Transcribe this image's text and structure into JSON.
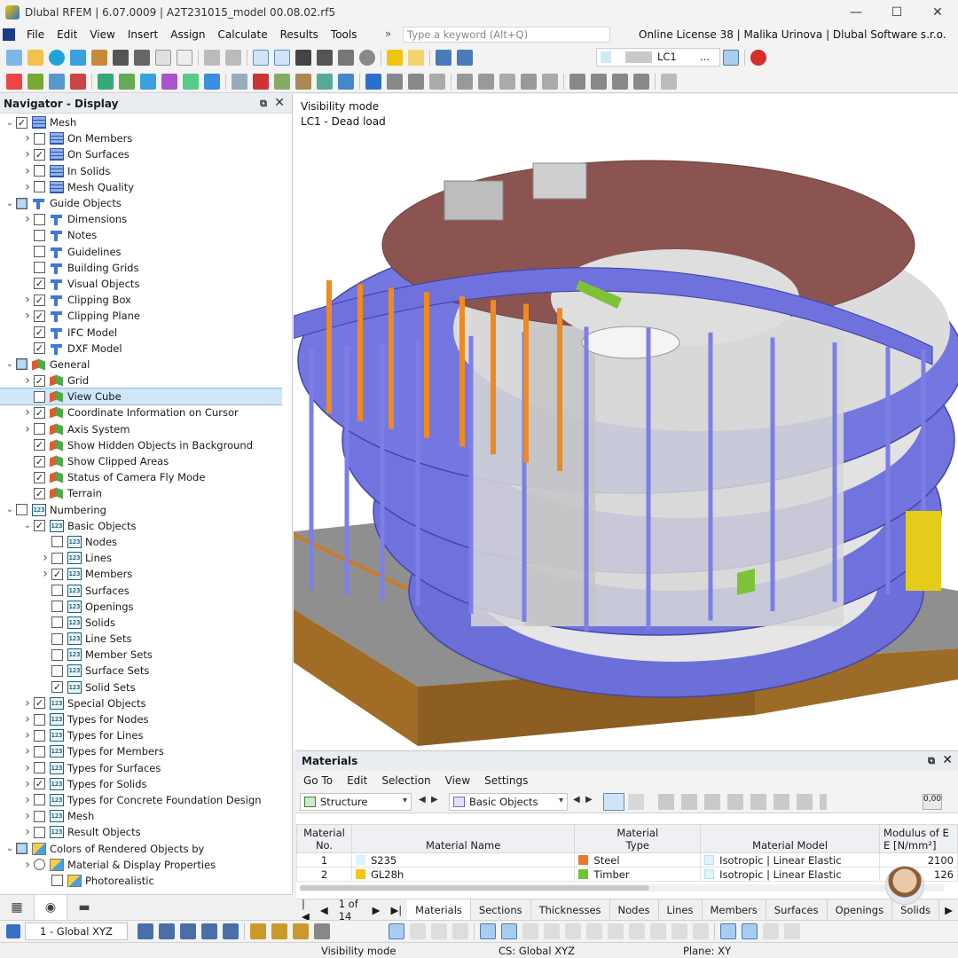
{
  "window": {
    "title": "Dlubal RFEM | 6.07.0009 | A2T231015_model 00.08.02.rf5",
    "minimize": "—",
    "maximize": "☐",
    "close": "✕"
  },
  "menu": {
    "items": [
      "File",
      "Edit",
      "View",
      "Insert",
      "Assign",
      "Calculate",
      "Results",
      "Tools"
    ],
    "more": "»",
    "search_placeholder": "Type a keyword (Alt+Q)",
    "license": "Online License 38 | Malika Urinova | Dlubal Software s.r.o."
  },
  "toolbar": {
    "load_case": "LC1",
    "load_case_more": "..."
  },
  "navigator": {
    "title": "Navigator - Display",
    "items": [
      {
        "label": "Mesh",
        "level": 0,
        "arrow": "open",
        "check": "checked",
        "icon": "mesh"
      },
      {
        "label": "On Members",
        "level": 1,
        "arrow": "closed",
        "check": "unchecked",
        "icon": "mesh"
      },
      {
        "label": "On Surfaces",
        "level": 1,
        "arrow": "closed",
        "check": "checked",
        "icon": "mesh"
      },
      {
        "label": "In Solids",
        "level": 1,
        "arrow": "closed",
        "check": "unchecked",
        "icon": "mesh"
      },
      {
        "label": "Mesh Quality",
        "level": 1,
        "arrow": "closed",
        "check": "unchecked",
        "icon": "mesh"
      },
      {
        "label": "Guide Objects",
        "level": 0,
        "arrow": "open",
        "check": "partial",
        "icon": "guide"
      },
      {
        "label": "Dimensions",
        "level": 1,
        "arrow": "closed",
        "check": "unchecked",
        "icon": "guide"
      },
      {
        "label": "Notes",
        "level": 1,
        "arrow": "none",
        "check": "unchecked",
        "icon": "guide"
      },
      {
        "label": "Guidelines",
        "level": 1,
        "arrow": "none",
        "check": "unchecked",
        "icon": "guide"
      },
      {
        "label": "Building Grids",
        "level": 1,
        "arrow": "none",
        "check": "unchecked",
        "icon": "guide"
      },
      {
        "label": "Visual Objects",
        "level": 1,
        "arrow": "none",
        "check": "checked",
        "icon": "guide"
      },
      {
        "label": "Clipping Box",
        "level": 1,
        "arrow": "closed",
        "check": "checked",
        "icon": "guide"
      },
      {
        "label": "Clipping Plane",
        "level": 1,
        "arrow": "closed",
        "check": "checked",
        "icon": "guide"
      },
      {
        "label": "IFC Model",
        "level": 1,
        "arrow": "none",
        "check": "checked",
        "icon": "guide"
      },
      {
        "label": "DXF Model",
        "level": 1,
        "arrow": "none",
        "check": "checked",
        "icon": "guide"
      },
      {
        "label": "General",
        "level": 0,
        "arrow": "open",
        "check": "partial",
        "icon": "general"
      },
      {
        "label": "Grid",
        "level": 1,
        "arrow": "closed",
        "check": "checked",
        "icon": "general"
      },
      {
        "label": "View Cube",
        "level": 1,
        "arrow": "none",
        "check": "unchecked",
        "icon": "general",
        "selected": true
      },
      {
        "label": "Coordinate Information on Cursor",
        "level": 1,
        "arrow": "closed",
        "check": "checked",
        "icon": "general"
      },
      {
        "label": "Axis System",
        "level": 1,
        "arrow": "closed",
        "check": "unchecked",
        "icon": "general"
      },
      {
        "label": "Show Hidden Objects in Background",
        "level": 1,
        "arrow": "none",
        "check": "checked",
        "icon": "general"
      },
      {
        "label": "Show Clipped Areas",
        "level": 1,
        "arrow": "none",
        "check": "checked",
        "icon": "general"
      },
      {
        "label": "Status of Camera Fly Mode",
        "level": 1,
        "arrow": "none",
        "check": "checked",
        "icon": "general"
      },
      {
        "label": "Terrain",
        "level": 1,
        "arrow": "none",
        "check": "checked",
        "icon": "general"
      },
      {
        "label": "Numbering",
        "level": 0,
        "arrow": "open",
        "check": "unchecked",
        "icon": "num"
      },
      {
        "label": "Basic Objects",
        "level": 1,
        "arrow": "open",
        "check": "checked",
        "icon": "num"
      },
      {
        "label": "Nodes",
        "level": 2,
        "arrow": "none",
        "check": "unchecked",
        "icon": "num"
      },
      {
        "label": "Lines",
        "level": 2,
        "arrow": "closed",
        "check": "unchecked",
        "icon": "num"
      },
      {
        "label": "Members",
        "level": 2,
        "arrow": "closed",
        "check": "checked",
        "icon": "num"
      },
      {
        "label": "Surfaces",
        "level": 2,
        "arrow": "none",
        "check": "unchecked",
        "icon": "num"
      },
      {
        "label": "Openings",
        "level": 2,
        "arrow": "none",
        "check": "unchecked",
        "icon": "num"
      },
      {
        "label": "Solids",
        "level": 2,
        "arrow": "none",
        "check": "unchecked",
        "icon": "num"
      },
      {
        "label": "Line Sets",
        "level": 2,
        "arrow": "none",
        "check": "unchecked",
        "icon": "num"
      },
      {
        "label": "Member Sets",
        "level": 2,
        "arrow": "none",
        "check": "unchecked",
        "icon": "num"
      },
      {
        "label": "Surface Sets",
        "level": 2,
        "arrow": "none",
        "check": "unchecked",
        "icon": "num"
      },
      {
        "label": "Solid Sets",
        "level": 2,
        "arrow": "none",
        "check": "checked",
        "icon": "num"
      },
      {
        "label": "Special Objects",
        "level": 1,
        "arrow": "closed",
        "check": "checked",
        "icon": "num"
      },
      {
        "label": "Types for Nodes",
        "level": 1,
        "arrow": "closed",
        "check": "unchecked",
        "icon": "num"
      },
      {
        "label": "Types for Lines",
        "level": 1,
        "arrow": "closed",
        "check": "unchecked",
        "icon": "num"
      },
      {
        "label": "Types for Members",
        "level": 1,
        "arrow": "closed",
        "check": "unchecked",
        "icon": "num"
      },
      {
        "label": "Types for Surfaces",
        "level": 1,
        "arrow": "closed",
        "check": "unchecked",
        "icon": "num"
      },
      {
        "label": "Types for Solids",
        "level": 1,
        "arrow": "closed",
        "check": "checked",
        "icon": "num"
      },
      {
        "label": "Types for Concrete Foundation Design",
        "level": 1,
        "arrow": "closed",
        "check": "unchecked",
        "icon": "num"
      },
      {
        "label": "Mesh",
        "level": 1,
        "arrow": "closed",
        "check": "unchecked",
        "icon": "num"
      },
      {
        "label": "Result Objects",
        "level": 1,
        "arrow": "closed",
        "check": "unchecked",
        "icon": "num"
      },
      {
        "label": "Colors of Rendered Objects by",
        "level": 0,
        "arrow": "open",
        "check": "partial",
        "icon": "color"
      },
      {
        "label": "Material & Display Properties",
        "level": 1,
        "arrow": "closed",
        "check": "radio",
        "icon": "color"
      },
      {
        "label": "Photorealistic",
        "level": 2,
        "arrow": "none",
        "check": "unchecked",
        "icon": "color"
      }
    ]
  },
  "viewport": {
    "line1": "Visibility mode",
    "line2": "LC1 - Dead load"
  },
  "materials": {
    "title": "Materials",
    "menu": [
      "Go To",
      "Edit",
      "Selection",
      "View",
      "Settings"
    ],
    "combo1": "Structure",
    "combo2": "Basic Objects",
    "headers": {
      "no": [
        "Material",
        "No."
      ],
      "name": "Material Name",
      "type": [
        "Material",
        "Type"
      ],
      "model": "Material Model",
      "modulus": [
        "Modulus of E",
        "E [N/mm²]"
      ]
    },
    "rows": [
      {
        "no": "1",
        "name": "S235",
        "name_color": "#d9f3fb",
        "type": "Steel",
        "type_color": "#e87a2e",
        "model": "Isotropic | Linear Elastic",
        "modulus": "2100"
      },
      {
        "no": "2",
        "name": "GL28h",
        "name_color": "#f5c518",
        "type": "Timber",
        "type_color": "#6ec531",
        "model": "Isotropic | Linear Elastic",
        "modulus": "126"
      }
    ],
    "page": "1 of 14",
    "tabs": [
      "Materials",
      "Sections",
      "Thicknesses",
      "Nodes",
      "Lines",
      "Members",
      "Surfaces",
      "Openings",
      "Solids"
    ]
  },
  "bottom_toolbar": {
    "coord_system": "1 - Global XYZ"
  },
  "status": {
    "left": "Visibility mode",
    "cs": "CS: Global XYZ",
    "plane": "Plane: XY"
  },
  "colors": {
    "roof": "#8c5451",
    "slab": "#6f72dc",
    "column_blue": "#7d7fe6",
    "column_orange": "#f08a1e",
    "core": "#d9d9d9",
    "terrain": "#9c6b27",
    "terrain_top": "#8f8f8f"
  }
}
